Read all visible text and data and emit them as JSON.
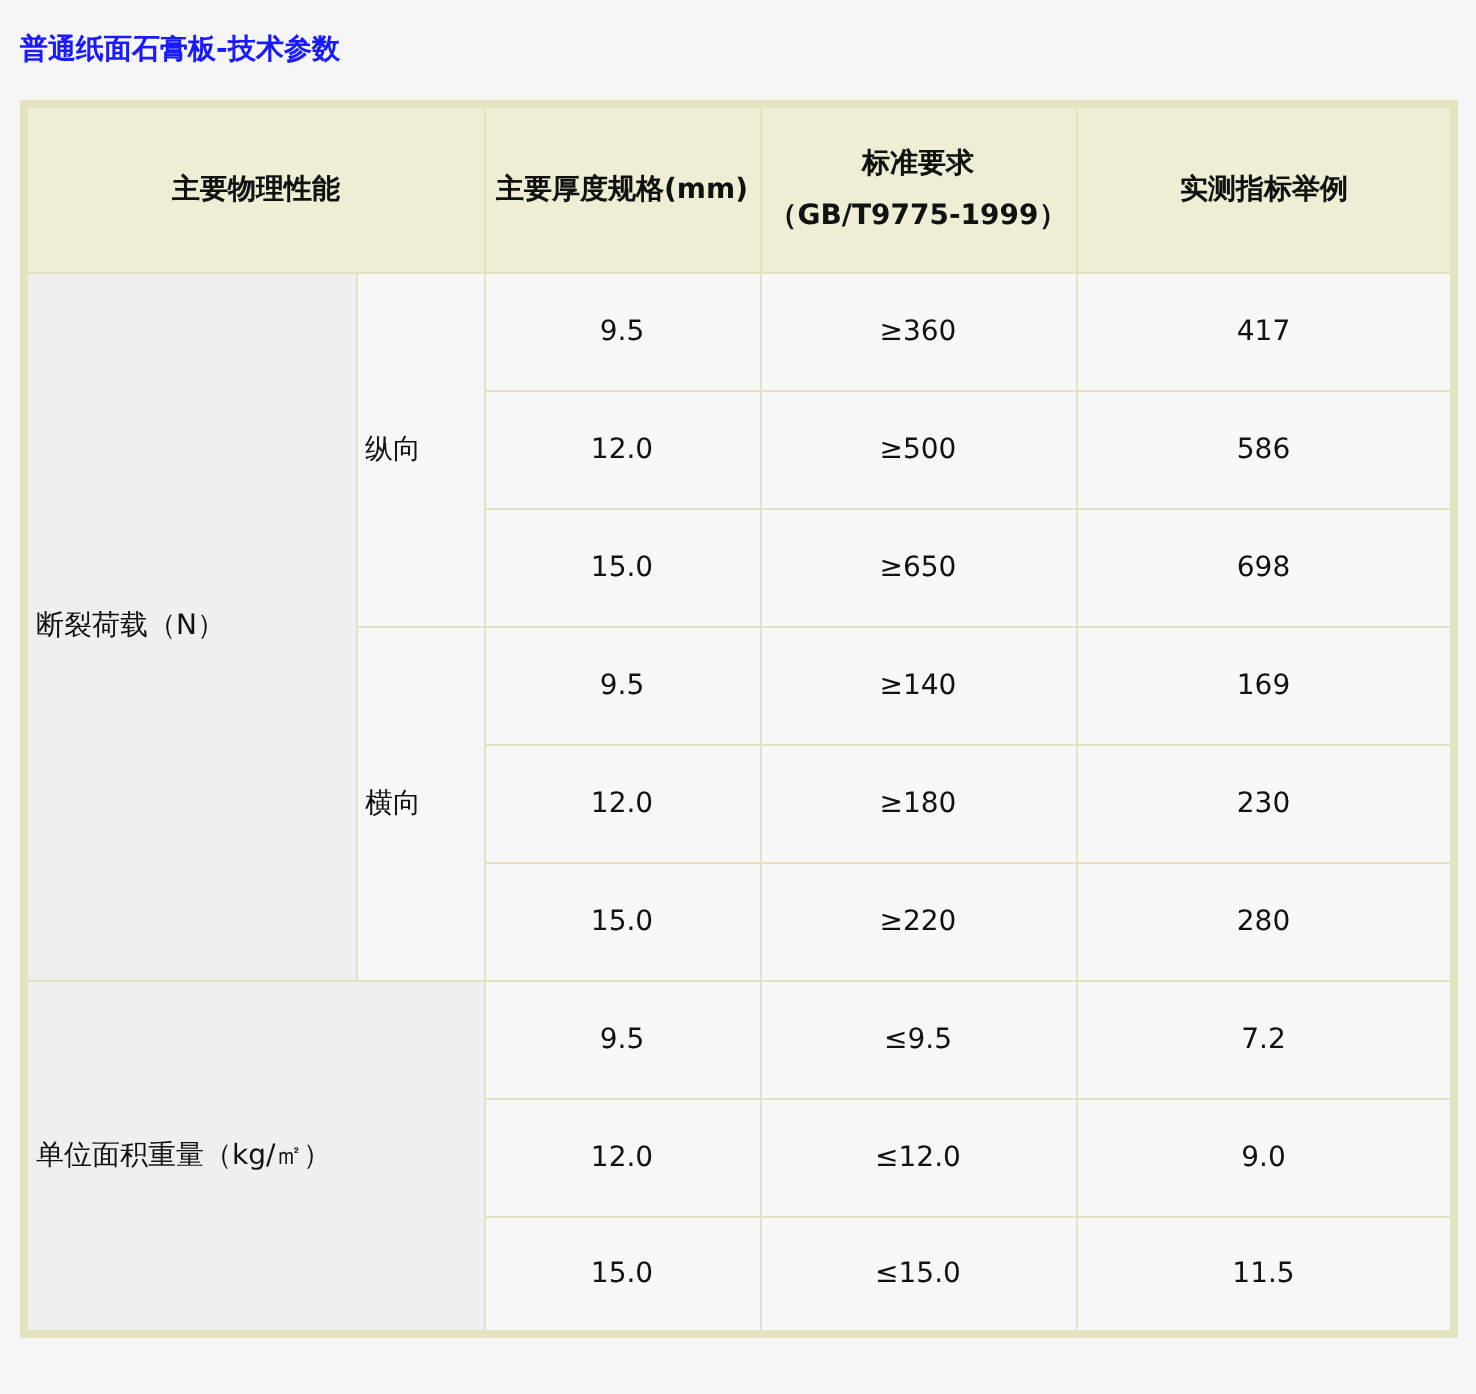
{
  "title": "普通纸面石膏板-技术参数",
  "table": {
    "columns": [
      "主要物理性能",
      "主要厚度规格(mm)",
      "标准要求（GB/T9775-1999）",
      "实测指标举例"
    ],
    "groups": [
      {
        "name": "断裂荷载（N）",
        "subgroups": [
          {
            "name": "纵向",
            "rows": [
              {
                "thickness": "9.5",
                "requirement": "≥360",
                "measured": "417"
              },
              {
                "thickness": "12.0",
                "requirement": "≥500",
                "measured": "586"
              },
              {
                "thickness": "15.0",
                "requirement": "≥650",
                "measured": "698"
              }
            ]
          },
          {
            "name": "横向",
            "rows": [
              {
                "thickness": "9.5",
                "requirement": "≥140",
                "measured": "169"
              },
              {
                "thickness": "12.0",
                "requirement": "≥180",
                "measured": "230"
              },
              {
                "thickness": "15.0",
                "requirement": "≥220",
                "measured": "280"
              }
            ]
          }
        ]
      },
      {
        "name": "单位面积重量（kg/㎡）",
        "rows": [
          {
            "thickness": "9.5",
            "requirement": "≤9.5",
            "measured": "7.2"
          },
          {
            "thickness": "12.0",
            "requirement": "≤12.0",
            "measured": "9.0"
          },
          {
            "thickness": "15.0",
            "requirement": "≤15.0",
            "measured": "11.5"
          }
        ]
      }
    ]
  }
}
